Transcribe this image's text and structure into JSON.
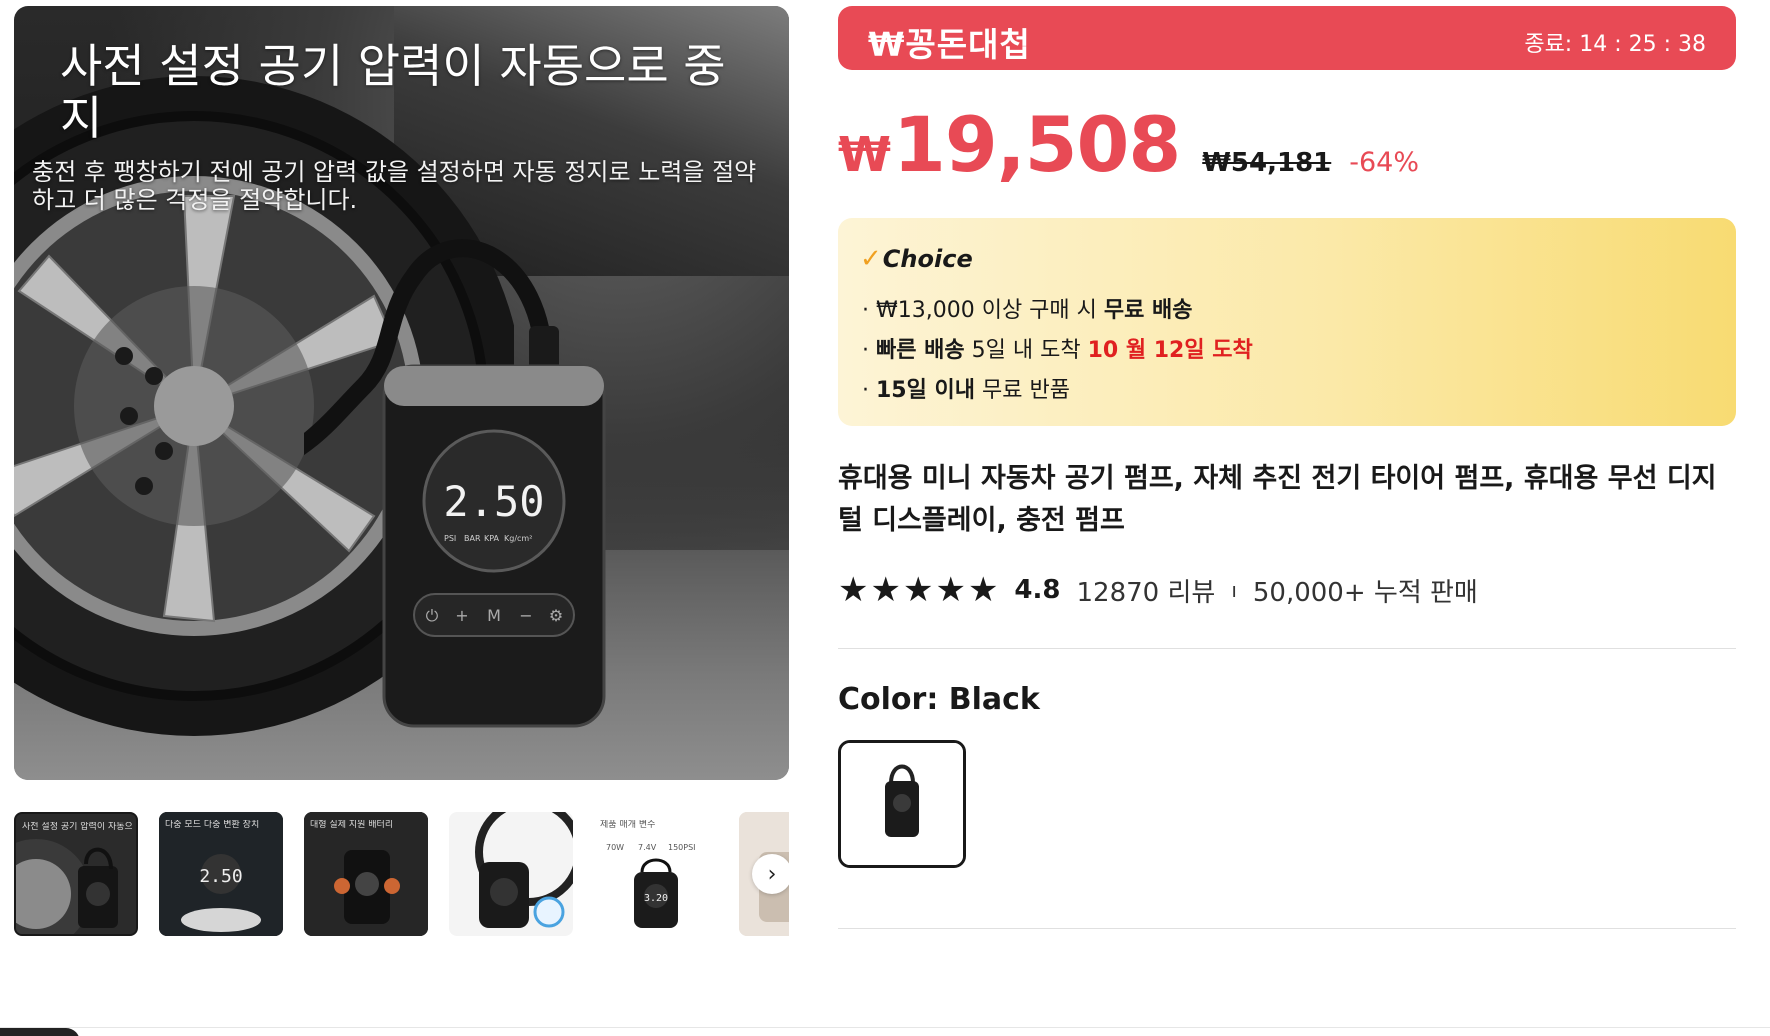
{
  "gallery": {
    "hero_title": "사전 설정 공기 압력이 자동으로 중지",
    "hero_subtitle": "충전 후 팽창하기 전에 공기 압력 값을 설정하면 자동 정지로 노력을 절약하고 더 많은 걱정을 절약합니다.",
    "pump_display": "2.50",
    "pump_units": [
      "PSI",
      "BAR",
      "KPA",
      "Kg/cm²"
    ],
    "pump_buttons": [
      "⏻",
      "+",
      "M",
      "−",
      "⚙"
    ],
    "thumbnails": [
      {
        "caption": "사전 설정 공기 압력이 자동으로",
        "display": ""
      },
      {
        "caption": "다중 모드 다중 변환 장치",
        "display": "2.50"
      },
      {
        "caption": "대형 실제 지원 배터리",
        "display": ""
      },
      {
        "caption": "",
        "display": ""
      },
      {
        "caption": "제품 매개 변수",
        "display": "3.20",
        "specs": [
          "70W",
          "7.4V",
          "150PSI"
        ]
      },
      {
        "caption": "",
        "display": ""
      }
    ],
    "next_arrow": "›"
  },
  "deal": {
    "logo": "₩꽁돈대첩",
    "timer": "종료: 14 : 25 : 38"
  },
  "price": {
    "currency": "₩",
    "current": "19,508",
    "original": "₩54,181",
    "discount": "-64%"
  },
  "choice": {
    "label": "Choice",
    "line1_a": "· ₩13,000 이상 구매 시 ",
    "line1_b": "무료 배송",
    "line2_a": "· ",
    "line2_b": "빠른 배송",
    "line2_c": " 5일 내 도착 ",
    "line2_d": "10 월 12일 도착",
    "line3_a": "· ",
    "line3_b": "15일 이내",
    "line3_c": "  무료 반품"
  },
  "product": {
    "title": "휴대용 미니 자동차 공기 펌프, 자체 추진 전기 타이어 펌프, 휴대용 무선 디지털 디스플레이, 충전 펌프"
  },
  "rating": {
    "stars": 4.8,
    "value": "4.8",
    "reviews": "12870 리뷰",
    "separator": "ı",
    "sold": "50,000+ 누적 판매"
  },
  "variant": {
    "color_label": "Color: Black"
  },
  "colors": {
    "accent": "#e84a55",
    "choice_start": "#fdf4d6",
    "choice_end": "#f8db72",
    "red_text": "#e02020"
  }
}
